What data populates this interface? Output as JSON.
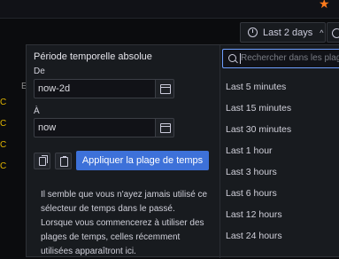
{
  "toolbar": {
    "time_range_label": "Last 2 days"
  },
  "picker": {
    "title": "Période temporelle absolue",
    "from_label": "De",
    "from_value": "now-2d",
    "to_label": "À",
    "to_value": "now",
    "apply_label": "Appliquer la plage de temps",
    "info_text": "Il semble que vous n'ayez jamais utilisé ce sélecteur de temps dans le passé. Lorsque vous commencerez à utiliser des plages de temps, celles récemment utilisées apparaîtront ici.",
    "search_placeholder": "Rechercher dans les plages",
    "options": [
      "Last 5 minutes",
      "Last 15 minutes",
      "Last 30 minutes",
      "Last 1 hour",
      "Last 3 hours",
      "Last 6 hours",
      "Last 12 hours",
      "Last 24 hours"
    ]
  },
  "background": {
    "left_letters": [
      "C",
      "C",
      "C",
      "C"
    ],
    "b_letter": "E"
  },
  "colors": {
    "accent": "#3d71d9",
    "focus": "#6e9fff",
    "star": "#ff7b1c"
  },
  "icons": [
    "star-icon",
    "clock-icon",
    "chevron-up-icon",
    "zoom-icon",
    "calendar-icon",
    "copy-icon",
    "clipboard-icon",
    "search-icon"
  ]
}
